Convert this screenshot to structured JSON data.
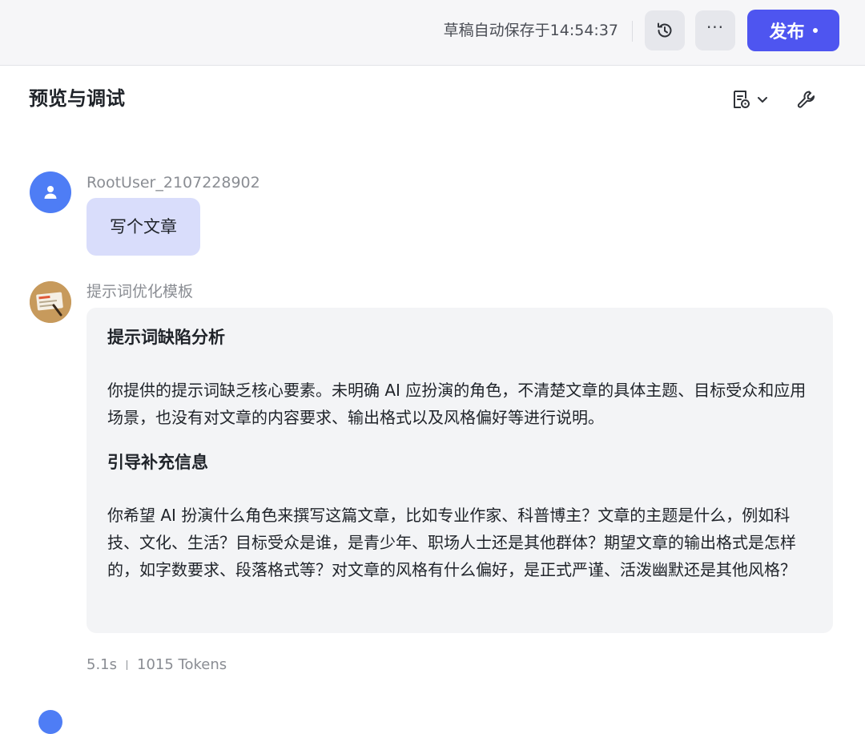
{
  "topbar": {
    "autosave_text": "草稿自动保存于14:54:37",
    "history_icon": "history-clock-icon",
    "more_label": "···",
    "publish_label": "发布"
  },
  "panel": {
    "title": "预览与调试",
    "tools": [
      "document-settings-icon",
      "chevron-down-icon",
      "wrench-icon"
    ]
  },
  "conversation": {
    "user": {
      "name": "RootUser_2107228902",
      "message": "写个文章"
    },
    "bot": {
      "name": "提示词优化模板",
      "sections": [
        {
          "heading": "提示词缺陷分析",
          "paragraph": "你提供的提示词缺乏核心要素。未明确 AI 应扮演的角色，不清楚文章的具体主题、目标受众和应用场景，也没有对文章的内容要求、输出格式以及风格偏好等进行说明。"
        },
        {
          "heading": "引导补充信息",
          "paragraph": "你希望 AI 扮演什么角色来撰写这篇文章，比如专业作家、科普博主？文章的主题是什么，例如科技、文化、生活？目标受众是谁，是青少年、职场人士还是其他群体？期望文章的输出格式是怎样的，如字数要求、段落格式等？对文章的风格有什么偏好，是正式严谨、活泼幽默还是其他风格？"
        }
      ],
      "meta": {
        "time": "5.1s",
        "tokens": "1015 Tokens"
      }
    }
  },
  "colors": {
    "accent": "#4e55f0",
    "user_bubble": "#d9ddfb",
    "bot_bubble": "#f3f4f6",
    "topbar_bg": "#f6f6f8"
  }
}
